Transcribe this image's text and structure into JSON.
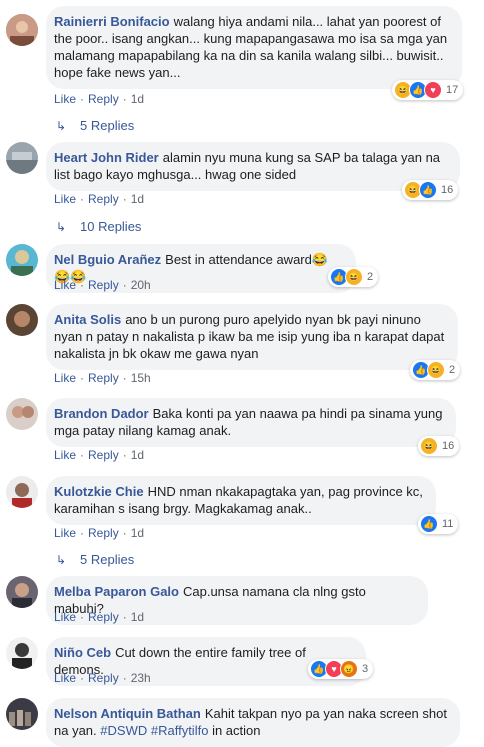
{
  "actions": {
    "like": "Like",
    "reply": "Reply",
    "sep": "·"
  },
  "comments": [
    {
      "author": "Rainierri Bonifacio",
      "text": "walang hiya andami nila... lahat yan poorest of the poor.. isang angkan... kung mapapangasawa mo isa sa mga yan malamang mapapabilang ka na din sa kanila walang silbi... buwisit.. hope fake news yan...",
      "time": "1d",
      "react_count": "17",
      "reactions": [
        "haha-icon",
        "like-icon",
        "love-icon"
      ],
      "replies": "5 Replies"
    },
    {
      "author": "Heart John Rider",
      "text": "alamin nyu muna kung sa SAP ba talaga yan na list bago kayo mghusga... hwag one sided",
      "time": "1d",
      "react_count": "16",
      "reactions": [
        "haha-icon",
        "like-icon"
      ],
      "replies": "10 Replies"
    },
    {
      "author": "Nel Bguio Arañez",
      "text": "Best in attendance award",
      "time": "20h",
      "react_count": "2",
      "reactions": [
        "like-icon",
        "haha-icon"
      ]
    },
    {
      "author": "Anita Solis",
      "text": "ano b un purong puro apelyido nyan bk payi ninuno nyan n patay n nakalista p ikaw ba me isip yung iba n karapat dapat nakalista jn bk okaw me gawa nyan",
      "time": "15h",
      "react_count": "2",
      "reactions": [
        "like-icon",
        "haha-icon"
      ]
    },
    {
      "author": "Brandon Dador",
      "text": "Baka konti pa yan naawa pa hindi pa sinama yung mga patay nilang kamag anak.",
      "time": "1d",
      "react_count": "16",
      "reactions": [
        "haha-icon"
      ]
    },
    {
      "author": "Kulotzkie Chie",
      "text": "HND nman nkakapagtaka yan, pag province kc, karamihan s isang brgy. Magkakamag anak..",
      "time": "1d",
      "react_count": "11",
      "reactions": [
        "like-icon"
      ],
      "replies": "5 Replies"
    },
    {
      "author": "Melba Paparon Galo",
      "text": "Cap.unsa namana cla nlng gsto mabuhi?",
      "time": "1d"
    },
    {
      "author": "Niño Ceb",
      "text": "Cut down the entire family tree of demons.",
      "time": "23h",
      "react_count": "3",
      "reactions": [
        "like-icon",
        "love-icon",
        "angry-icon"
      ]
    },
    {
      "author": "Nelson Antiquin Bathan",
      "text": "Kahit takpan nyo pa yan naka screen shot na yan.",
      "hashtags": [
        "#DSWD",
        "#Raffytilfo"
      ],
      "text_after": "in action"
    }
  ]
}
